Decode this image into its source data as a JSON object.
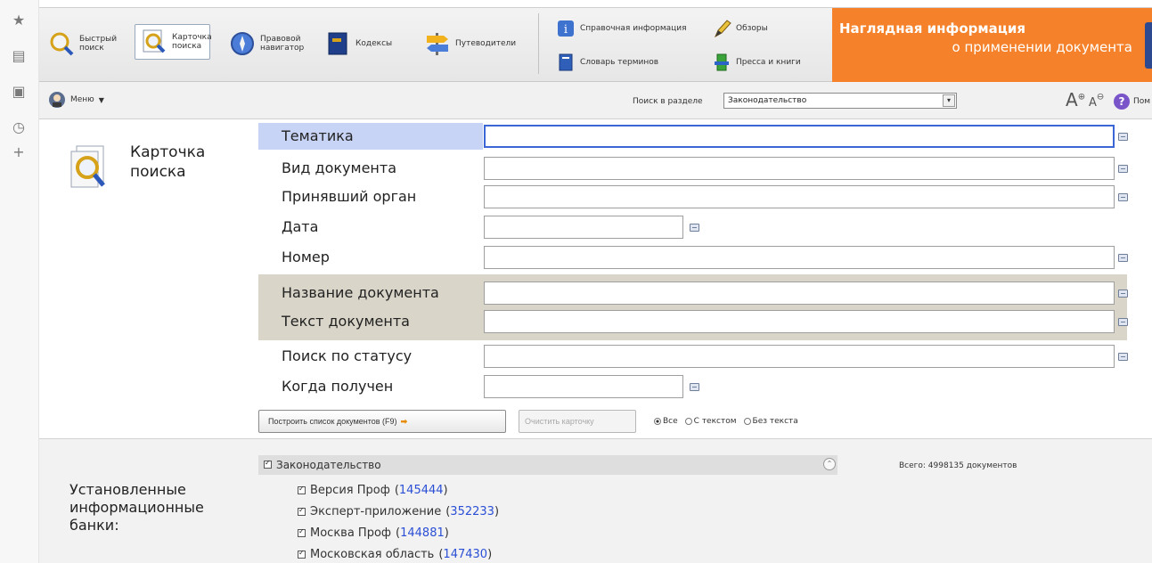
{
  "toolbar": {
    "quick_search": "Быстрый поиск",
    "search_card": "Карточка поиска",
    "legal_navigator": "Правовой навигатор",
    "codes": "Кодексы",
    "guides": "Путеводители",
    "reference_info": "Справочная информация",
    "reviews": "Обзоры",
    "glossary": "Словарь терминов",
    "press_books": "Пресса и книги",
    "promo_line1": "Наглядная информация",
    "promo_line2": "о применении документа"
  },
  "menubar": {
    "menu_label": "Меню",
    "search_in_label": "Поиск в разделе",
    "search_in_value": "Законодательство",
    "help_label": "Пом"
  },
  "card": {
    "title": "Карточка поиска",
    "fields": [
      {
        "label": "Тематика"
      },
      {
        "label": "Вид документа"
      },
      {
        "label": "Принявший орган"
      },
      {
        "label": "Дата"
      },
      {
        "label": "Номер"
      },
      {
        "label": "Название документа"
      },
      {
        "label": "Текст документа"
      },
      {
        "label": "Поиск по статусу"
      },
      {
        "label": "Когда получен"
      }
    ],
    "build_button": "Построить список документов (F9)",
    "clear_button": "Очистить карточку",
    "radios": [
      "Все",
      "С текстом",
      "Без текста"
    ],
    "selected_radio": "Все"
  },
  "banks": {
    "title": "Установленные информационные банки:",
    "section": "Законодательство",
    "total": "Всего: 4998135 документов",
    "items": [
      {
        "name": "Версия Проф",
        "count": "145444"
      },
      {
        "name": "Эксперт-приложение",
        "count": "352233"
      },
      {
        "name": "Москва Проф",
        "count": "144881"
      },
      {
        "name": "Московская область",
        "count": "147430"
      }
    ]
  },
  "colors": {
    "promo_orange": "#f5822a",
    "active_field_highlight": "#c7d4f5",
    "shaded_rows": "#d9d5c8",
    "count_link": "#2a4fd6"
  },
  "icons": [
    "star-icon",
    "note-icon",
    "bookmark-icon",
    "history-icon",
    "plus-icon",
    "magnifier-icon",
    "compass-icon",
    "book-icon",
    "signpost-icon",
    "info-icon",
    "pen-icon",
    "dictionary-icon",
    "book-stack-icon",
    "menu-avatar-icon",
    "font-increase-icon",
    "font-decrease-icon",
    "help-icon",
    "arrow-right-icon",
    "collapse-icon"
  ]
}
